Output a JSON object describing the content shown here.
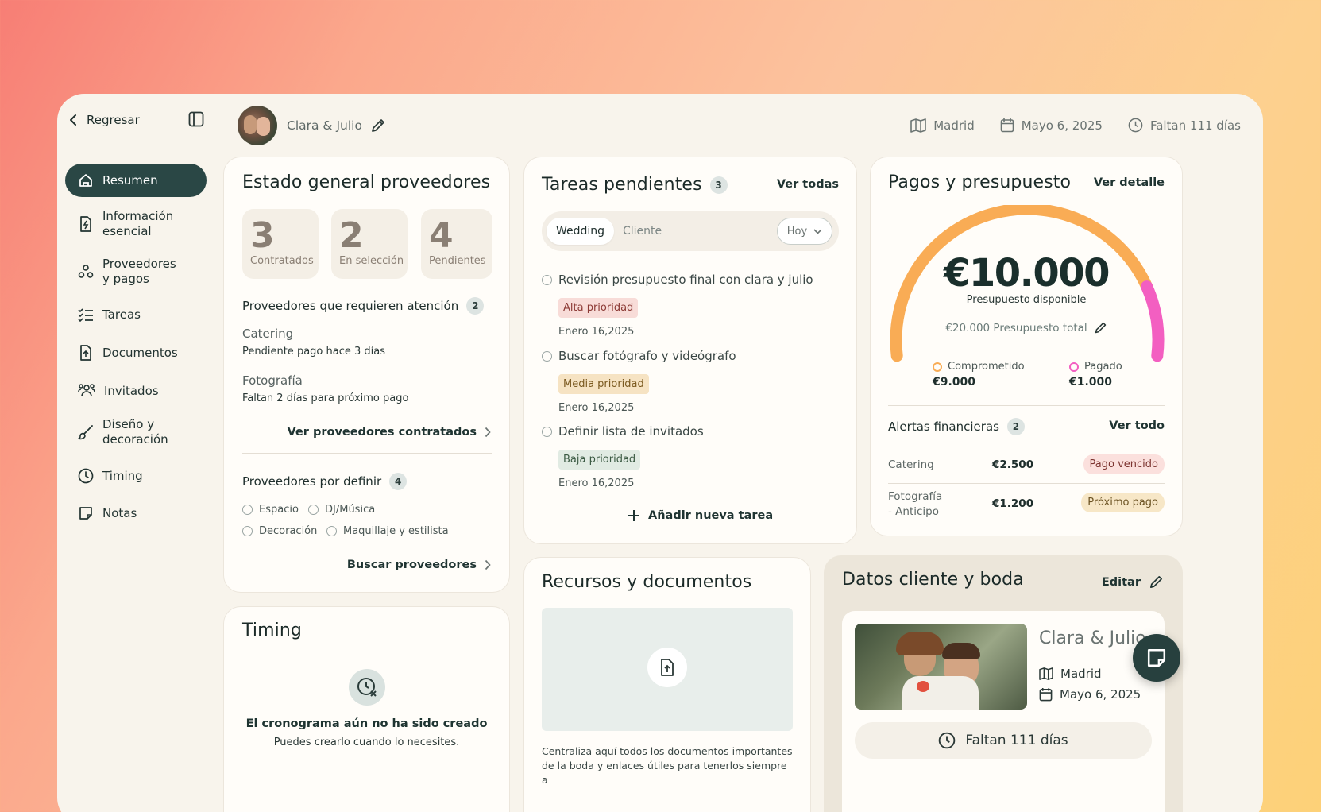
{
  "nav": {
    "back_label": "Regresar",
    "items": [
      {
        "label": "Resumen",
        "icon": "home-icon",
        "active": true
      },
      {
        "label": "Información\nesencial",
        "icon": "file-bolt-icon"
      },
      {
        "label": "Proveedores\ny pagos",
        "icon": "nodes-icon"
      },
      {
        "label": "Tareas",
        "icon": "checklist-icon"
      },
      {
        "label": "Documentos",
        "icon": "file-upload-icon"
      },
      {
        "label": "Invitados",
        "icon": "users-icon"
      },
      {
        "label": "Diseño y\ndecoración",
        "icon": "brush-icon"
      },
      {
        "label": "Timing",
        "icon": "clock-icon"
      },
      {
        "label": "Notas",
        "icon": "note-icon"
      }
    ]
  },
  "header": {
    "couple": "Clara & Julio",
    "city": "Madrid",
    "date": "Mayo 6, 2025",
    "countdown": "Faltan 111 días"
  },
  "proveedores": {
    "title": "Estado general proveedores",
    "stats": [
      {
        "number": "3",
        "label": "Contratados"
      },
      {
        "number": "2",
        "label": "En selección"
      },
      {
        "number": "4",
        "label": "Pendientes"
      }
    ],
    "attention_title": "Proveedores que requieren atención",
    "attention_count": "2",
    "attention": [
      {
        "name": "Catering",
        "status": "Pendiente pago hace 3 días"
      },
      {
        "name": "Fotografía",
        "status": "Faltan 2 días para próximo pago"
      }
    ],
    "view_contracted": "Ver proveedores contratados",
    "to_define_title": "Proveedores por definir",
    "to_define_count": "4",
    "to_define": [
      "Espacio",
      "DJ/Música",
      "Decoración",
      "Maquillaje y estilista"
    ],
    "search_link": "Buscar proveedores"
  },
  "timing": {
    "title": "Timing",
    "empty_title": "El cronograma aún no ha sido creado",
    "empty_sub": "Puedes crearlo cuando lo necesites."
  },
  "tareas": {
    "title": "Tareas pendientes",
    "count": "3",
    "view_all": "Ver todas",
    "tabs": [
      "Wedding",
      "Cliente"
    ],
    "filter": "Hoy",
    "items": [
      {
        "title": "Revisión presupuesto final con clara y julio",
        "priority": "Alta prioridad",
        "priority_color": "#f8dcd8",
        "priority_text": "#8c3a35",
        "date": "Enero 16,2025"
      },
      {
        "title": "Buscar fotógrafo y videógrafo",
        "priority": "Media prioridad",
        "priority_color": "#f6e3c3",
        "priority_text": "#7b5a20",
        "date": "Enero 16,2025"
      },
      {
        "title": "Definir lista de invitados",
        "priority": "Baja prioridad",
        "priority_color": "#e1ebe3",
        "priority_text": "#3b5a43",
        "date": "Enero 16,2025"
      }
    ],
    "add_label": "Añadir nueva tarea"
  },
  "recursos": {
    "title": "Recursos y documentos",
    "desc": "Centraliza aquí todos los documentos importantes de la boda y enlaces útiles para tenerlos siempre a"
  },
  "pagos": {
    "title": "Pagos y presupuesto",
    "view_detail": "Ver detalle",
    "gauge": {
      "total": 20000,
      "comprometido": 9000,
      "pagado": 1000,
      "orange": "#f9ac55",
      "pink": "#f35fc1"
    },
    "available_amount": "€10.000",
    "available_label": "Presupuesto disponible",
    "total_label": "€20.000 Presupuesto total",
    "legend": [
      {
        "label": "Comprometido",
        "value": "€9.000",
        "color": "#f9ac55"
      },
      {
        "label": "Pagado",
        "value": "€1.000",
        "color": "#f35fc1"
      }
    ],
    "alerts_title": "Alertas financieras",
    "alerts_count": "2",
    "view_all": "Ver todo",
    "alerts": [
      {
        "concept": "Catering",
        "amount": "€2.500",
        "status": "Pago vencido",
        "bg": "#fbe0dd",
        "fg": "#7d3531"
      },
      {
        "concept": "Fotografía\n- Anticipo",
        "amount": "€1.200",
        "status": "Próximo pago",
        "bg": "#f7e7c7",
        "fg": "#6d5424"
      }
    ]
  },
  "datos": {
    "title": "Datos cliente y boda",
    "edit": "Editar",
    "couple": "Clara & Julio",
    "city": "Madrid",
    "date": "Mayo 6, 2025",
    "countdown": "Faltan 111 días"
  }
}
